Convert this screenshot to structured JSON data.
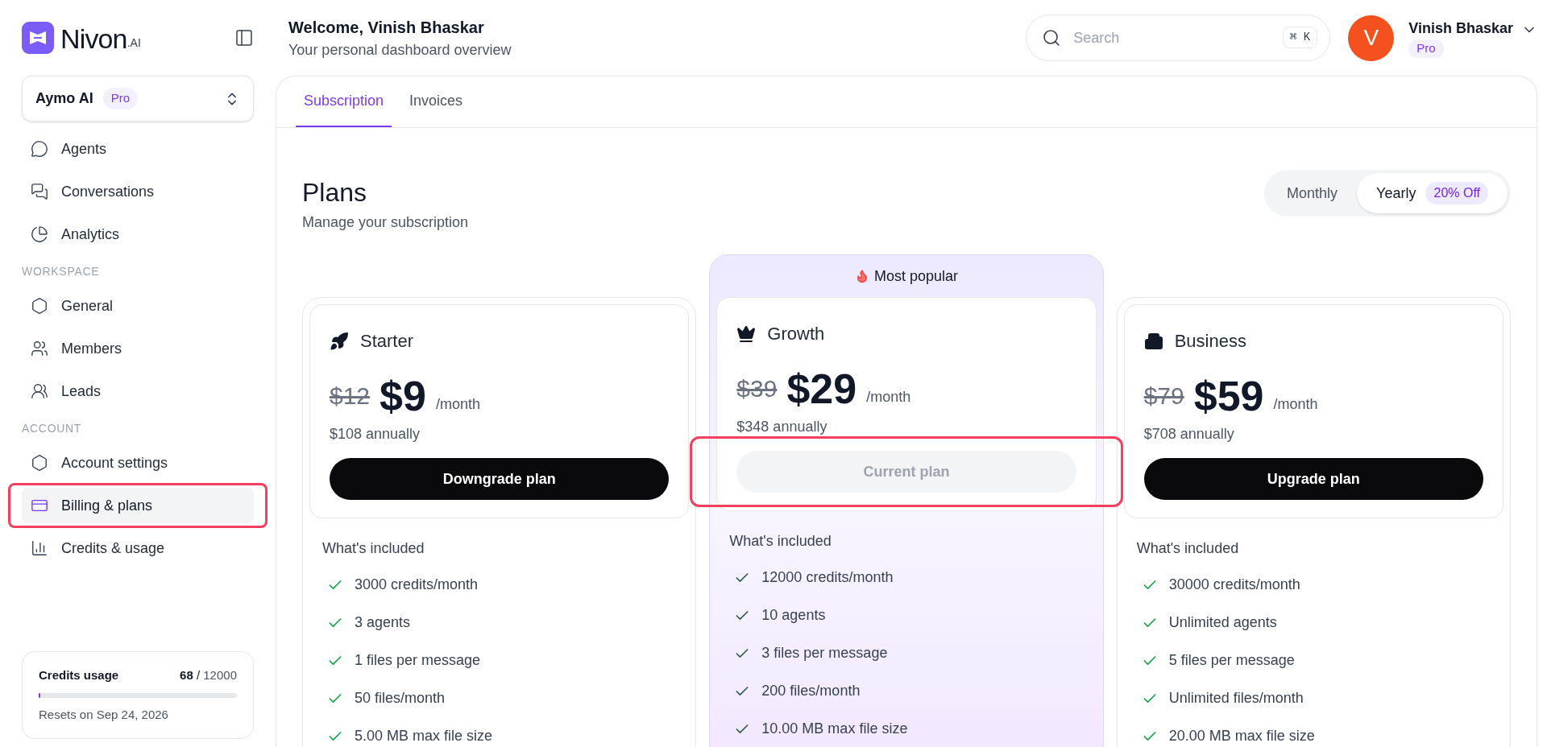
{
  "brand": {
    "name": "Nivon",
    "suffix": ".AI"
  },
  "workspace_switcher": {
    "name": "Aymo AI",
    "badge": "Pro"
  },
  "sidebar": {
    "sections": [
      {
        "items": [
          {
            "label": "Agents",
            "selected": false,
            "annotated": false
          },
          {
            "label": "Conversations",
            "selected": false,
            "annotated": false
          },
          {
            "label": "Analytics",
            "selected": false,
            "annotated": false
          }
        ]
      },
      {
        "heading": "WORKSPACE",
        "items": [
          {
            "label": "General",
            "selected": false,
            "annotated": false
          },
          {
            "label": "Members",
            "selected": false,
            "annotated": false
          },
          {
            "label": "Leads",
            "selected": false,
            "annotated": false
          }
        ]
      },
      {
        "heading": "ACCOUNT",
        "items": [
          {
            "label": "Account settings",
            "selected": false,
            "annotated": false
          },
          {
            "label": "Billing & plans",
            "selected": true,
            "annotated": true
          },
          {
            "label": "Credits & usage",
            "selected": false,
            "annotated": false
          }
        ]
      }
    ]
  },
  "credits_card": {
    "title": "Credits usage",
    "used": "68",
    "separator": "/",
    "total": "12000",
    "level": 0.01,
    "note": "Resets on Sep 24, 2026"
  },
  "header": {
    "title": "Welcome, Vinish Bhaskar",
    "subtitle": "Your personal dashboard overview"
  },
  "search": {
    "placeholder": "Search",
    "shortcut": "⌘ K"
  },
  "user": {
    "initial": "V",
    "name": "Vinish Bhaskar",
    "badge": "Pro"
  },
  "tabs": [
    {
      "label": "Subscription",
      "selected": true
    },
    {
      "label": "Invoices",
      "selected": false
    }
  ],
  "plans_section": {
    "title": "Plans",
    "subtitle": "Manage your subscription"
  },
  "billing_toggle": [
    {
      "label": "Monthly",
      "selected": false
    },
    {
      "label": "Yearly",
      "selected": true,
      "badge": "20% Off"
    }
  ],
  "plans": [
    {
      "name": "Starter",
      "old_price": "$12",
      "price": "$9",
      "period": "/month",
      "annual": "$108 annually",
      "button": {
        "label": "Downgrade plan",
        "disabled": false,
        "annotated": false
      },
      "features_title": "What's included",
      "features": [
        "3000 credits/month",
        "3 agents",
        "1 files per message",
        "50 files/month",
        "5.00 MB max file size"
      ]
    },
    {
      "name": "Growth",
      "ribbon": "Most popular",
      "old_price": "$39",
      "price": "$29",
      "period": "/month",
      "annual": "$348 annually",
      "button": {
        "label": "Current plan",
        "disabled": true,
        "annotated": true
      },
      "features_title": "What's included",
      "features": [
        "12000 credits/month",
        "10 agents",
        "3 files per message",
        "200 files/month",
        "10.00 MB max file size"
      ]
    },
    {
      "name": "Business",
      "old_price": "$79",
      "price": "$59",
      "period": "/month",
      "annual": "$708 annually",
      "button": {
        "label": "Upgrade plan",
        "disabled": false,
        "annotated": false
      },
      "features_title": "What's included",
      "features": [
        "30000 credits/month",
        "Unlimited agents",
        "5 files per message",
        "Unlimited files/month",
        "20.00 MB max file size"
      ]
    }
  ]
}
